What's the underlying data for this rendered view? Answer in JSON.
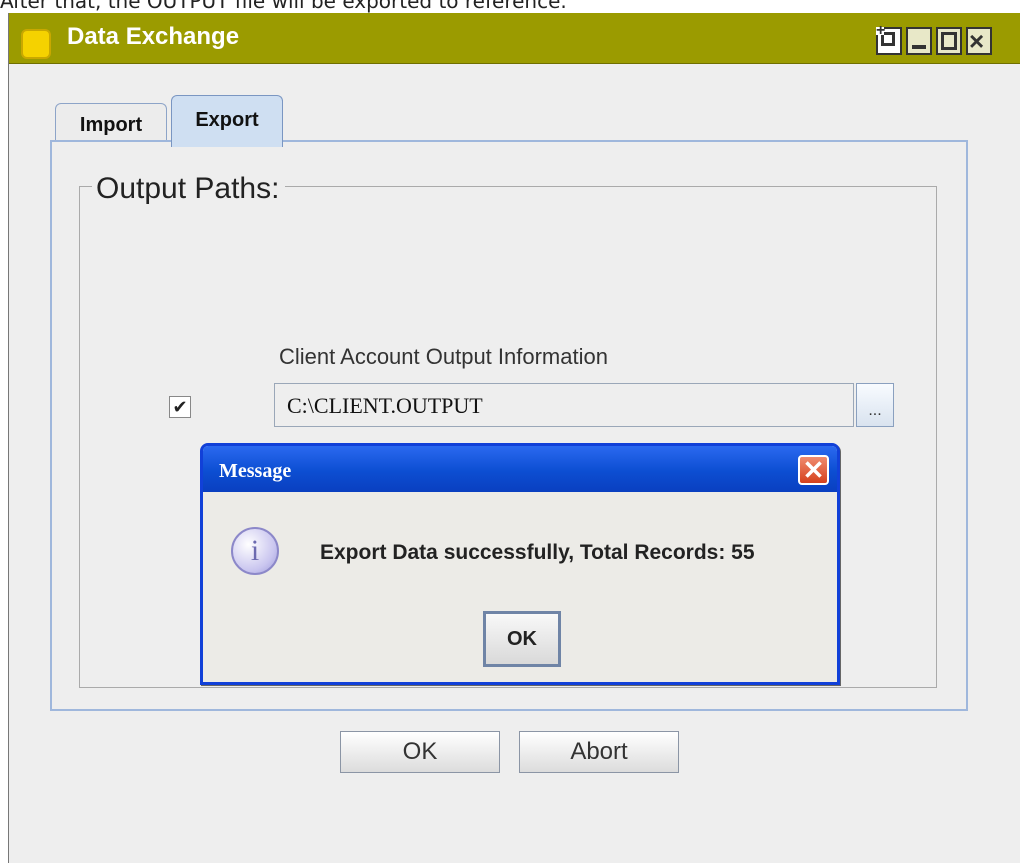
{
  "document": {
    "intro_text": "After that, the OUTPUT file will be exported to reference."
  },
  "window": {
    "title": "Data Exchange",
    "icon": "yellow-square-icon",
    "titlebar_color": "#9b9b00"
  },
  "tabs": [
    {
      "label": "Import",
      "selected": false
    },
    {
      "label": "Export",
      "selected": true
    }
  ],
  "main": {
    "group_title": "Output Paths:",
    "field_label": "Client Account Output Information",
    "checkbox_mark": "✔",
    "output_path_value": "C:\\CLIENT.OUTPUT",
    "browse_label": "..."
  },
  "footer": {
    "ok_label": "OK",
    "abort_label": "Abort"
  },
  "dialog": {
    "title": "Message",
    "close_glyph": "✕",
    "info_glyph": "i",
    "message": "Export Data successfully, Total Records: 55",
    "ok_label": "OK"
  },
  "colors": {
    "dialog_accent": "#1140d8",
    "tab_selected": "#cfdff2"
  }
}
